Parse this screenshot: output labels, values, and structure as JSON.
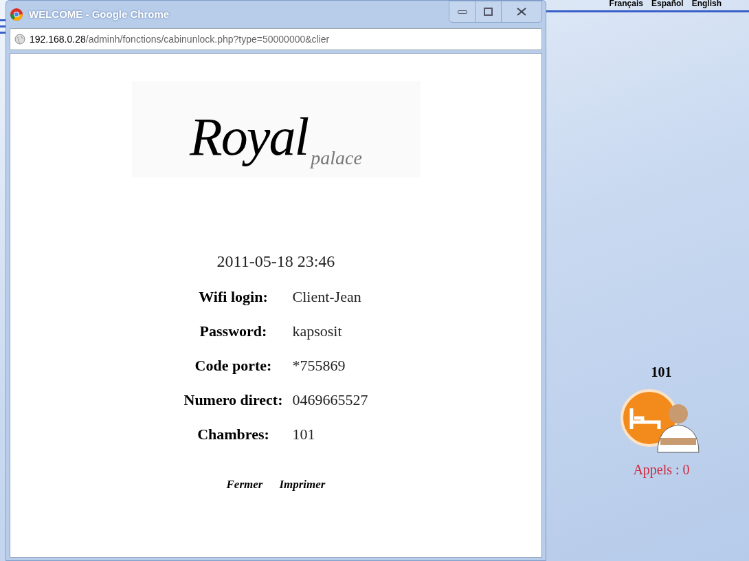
{
  "languages": [
    {
      "label": "Français"
    },
    {
      "label": "Español"
    },
    {
      "label": "English"
    }
  ],
  "popup": {
    "title": "WELCOME - Google Chrome",
    "url_host": "192.168.0.28",
    "url_path": "/adminh/fonctions/cabinunlock.php?type=50000000&clier",
    "logo": {
      "main": "Royal",
      "sub": "palace"
    },
    "datetime": "2011-05-18 23:46",
    "fields": [
      {
        "label": "Wifi login:",
        "value": "Client-Jean"
      },
      {
        "label": "Password:",
        "value": "kapsosit"
      },
      {
        "label": "Code porte:",
        "value": "*755869"
      },
      {
        "label": "Numero direct:",
        "value": "0469665527"
      },
      {
        "label": "Chambres:",
        "value": "101"
      }
    ],
    "actions": [
      "Fermer",
      "Imprimer"
    ]
  },
  "room": {
    "number": "101",
    "calls": "Appels : 0"
  }
}
